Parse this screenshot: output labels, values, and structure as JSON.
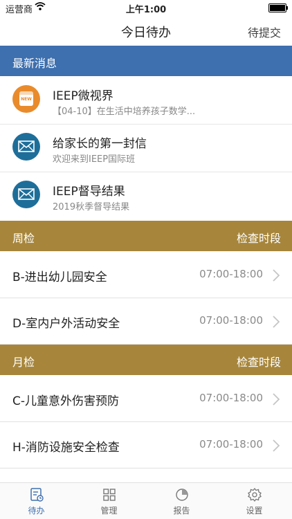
{
  "status_bar": {
    "carrier": "运营商",
    "time": "上午1:00"
  },
  "nav": {
    "title": "今日待办",
    "right_action": "待提交"
  },
  "news": {
    "header": "最新消息",
    "items": [
      {
        "title": "IEEP微视界",
        "subtitle": "【04-10】在生活中培养孩子数学...",
        "icon": "calendar-new-icon",
        "badge": "NEW"
      },
      {
        "title": "给家长的第一封信",
        "subtitle": "欢迎来到IEEP国际班",
        "icon": "mail-icon"
      },
      {
        "title": "IEEP督导结果",
        "subtitle": "2019秋季督导结果",
        "icon": "mail-icon"
      }
    ]
  },
  "weekly": {
    "header": "周检",
    "header_right": "检查时段",
    "rows": [
      {
        "name": "B-进出幼儿园安全",
        "time": "07:00-18:00"
      },
      {
        "name": "D-室内户外活动安全",
        "time": "07:00-18:00"
      }
    ]
  },
  "monthly": {
    "header": "月检",
    "header_right": "检查时段",
    "rows": [
      {
        "name": "C-儿童意外伤害预防",
        "time": "07:00-18:00"
      },
      {
        "name": "H-消防设施安全检查",
        "time": "07:00-18:00"
      }
    ]
  },
  "tabs": [
    {
      "label": "待办",
      "icon": "todo-icon",
      "active": true
    },
    {
      "label": "管理",
      "icon": "grid-icon"
    },
    {
      "label": "报告",
      "icon": "pie-chart-icon"
    },
    {
      "label": "设置",
      "icon": "gear-icon"
    }
  ],
  "colors": {
    "news_header": "#3e6fae",
    "section_header": "#a7863b",
    "accent_orange": "#e98b2b",
    "accent_blue": "#1e6e9a"
  }
}
